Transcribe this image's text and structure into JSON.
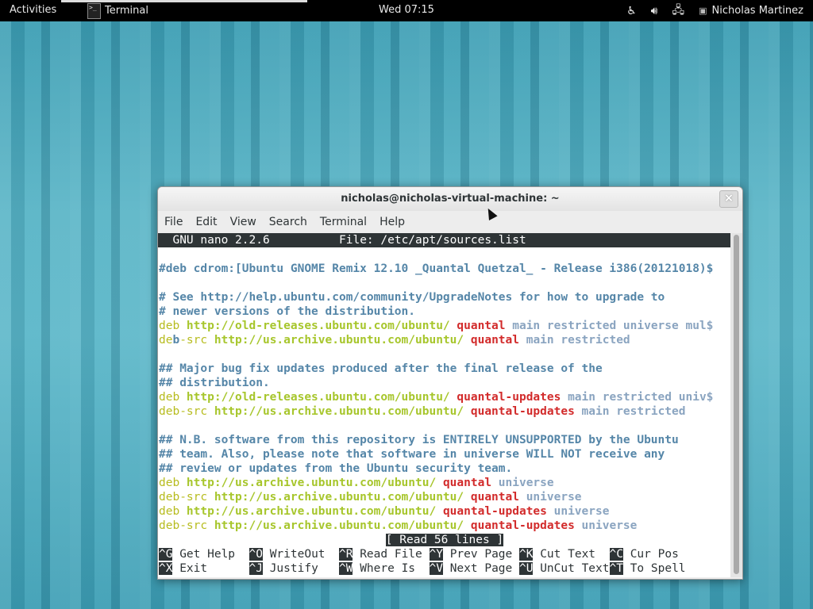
{
  "topbar": {
    "activities": "Activities",
    "app_name": "Terminal",
    "app_icon_text": ">_",
    "clock": "Wed 07:15",
    "user_name": "Nicholas Martinez"
  },
  "window": {
    "title": "nicholas@nicholas-virtual-machine: ~",
    "close_glyph": "×",
    "menu": [
      "File",
      "Edit",
      "View",
      "Search",
      "Terminal",
      "Help"
    ]
  },
  "nano": {
    "header_left": "  GNU nano 2.2.6",
    "header_file": "File: /etc/apt/sources.list",
    "lines": [
      [],
      [
        {
          "t": "#deb cdrom:[Ubuntu GNOME Remix 12.10 _Quantal Quetzal_ - Release i386(20121018)$",
          "c": "cmt"
        }
      ],
      [],
      [
        {
          "t": "# See http://help.ubuntu.com/community/UpgradeNotes for how to upgrade to",
          "c": "cmt"
        }
      ],
      [
        {
          "t": "# newer versions of the distribution.",
          "c": "cmt"
        }
      ],
      [
        {
          "t": "deb ",
          "c": "deb"
        },
        {
          "t": "http://old-releases.ubuntu.com/ubuntu/ ",
          "c": "url"
        },
        {
          "t": "quantal",
          "c": "red"
        },
        {
          "t": " main restricted universe mul$",
          "c": "comp"
        }
      ],
      [
        {
          "t": "de",
          "c": "deb"
        },
        {
          "t": "b",
          "c": "cursor"
        },
        {
          "t": "-src ",
          "c": "deb"
        },
        {
          "t": "http://us.archive.ubuntu.com/ubuntu/ ",
          "c": "url"
        },
        {
          "t": "quantal",
          "c": "red"
        },
        {
          "t": " main restricted",
          "c": "comp"
        }
      ],
      [],
      [
        {
          "t": "## Major bug fix updates produced after the final release of the",
          "c": "cmt"
        }
      ],
      [
        {
          "t": "## distribution.",
          "c": "cmt"
        }
      ],
      [
        {
          "t": "deb ",
          "c": "deb"
        },
        {
          "t": "http://old-releases.ubuntu.com/ubuntu/ ",
          "c": "url"
        },
        {
          "t": "quantal-updates",
          "c": "red"
        },
        {
          "t": " main restricted univ$",
          "c": "comp"
        }
      ],
      [
        {
          "t": "deb-src ",
          "c": "deb"
        },
        {
          "t": "http://us.archive.ubuntu.com/ubuntu/ ",
          "c": "url"
        },
        {
          "t": "quantal-updates",
          "c": "red"
        },
        {
          "t": " main restricted",
          "c": "comp"
        }
      ],
      [],
      [
        {
          "t": "## N.B. software from this repository is ENTIRELY UNSUPPORTED by the Ubuntu",
          "c": "cmt"
        }
      ],
      [
        {
          "t": "## team. Also, please note that software in universe WILL NOT receive any",
          "c": "cmt"
        }
      ],
      [
        {
          "t": "## review or updates from the Ubuntu security team.",
          "c": "cmt"
        }
      ],
      [
        {
          "t": "deb ",
          "c": "deb"
        },
        {
          "t": "http://us.archive.ubuntu.com/ubuntu/ ",
          "c": "url"
        },
        {
          "t": "quantal",
          "c": "red"
        },
        {
          "t": " universe",
          "c": "comp"
        }
      ],
      [
        {
          "t": "deb-src ",
          "c": "deb"
        },
        {
          "t": "http://us.archive.ubuntu.com/ubuntu/ ",
          "c": "url"
        },
        {
          "t": "quantal",
          "c": "red"
        },
        {
          "t": " universe",
          "c": "comp"
        }
      ],
      [
        {
          "t": "deb ",
          "c": "deb"
        },
        {
          "t": "http://us.archive.ubuntu.com/ubuntu/ ",
          "c": "url"
        },
        {
          "t": "quantal-updates",
          "c": "red"
        },
        {
          "t": " universe",
          "c": "comp"
        }
      ],
      [
        {
          "t": "deb-src ",
          "c": "deb"
        },
        {
          "t": "http://us.archive.ubuntu.com/ubuntu/ ",
          "c": "url"
        },
        {
          "t": "quantal-updates",
          "c": "red"
        },
        {
          "t": " universe",
          "c": "comp"
        }
      ]
    ],
    "status": "[ Read 56 lines ]",
    "shortcuts_row1": [
      {
        "key": "^G",
        "label": " Get Help  "
      },
      {
        "key": "^O",
        "label": " WriteOut  "
      },
      {
        "key": "^R",
        "label": " Read File "
      },
      {
        "key": "^Y",
        "label": " Prev Page "
      },
      {
        "key": "^K",
        "label": " Cut Text  "
      },
      {
        "key": "^C",
        "label": " Cur Pos"
      }
    ],
    "shortcuts_row2": [
      {
        "key": "^X",
        "label": " Exit      "
      },
      {
        "key": "^J",
        "label": " Justify   "
      },
      {
        "key": "^W",
        "label": " Where Is  "
      },
      {
        "key": "^V",
        "label": " Next Page "
      },
      {
        "key": "^U",
        "label": " UnCut Text"
      },
      {
        "key": "^T",
        "label": " To Spell"
      }
    ]
  }
}
